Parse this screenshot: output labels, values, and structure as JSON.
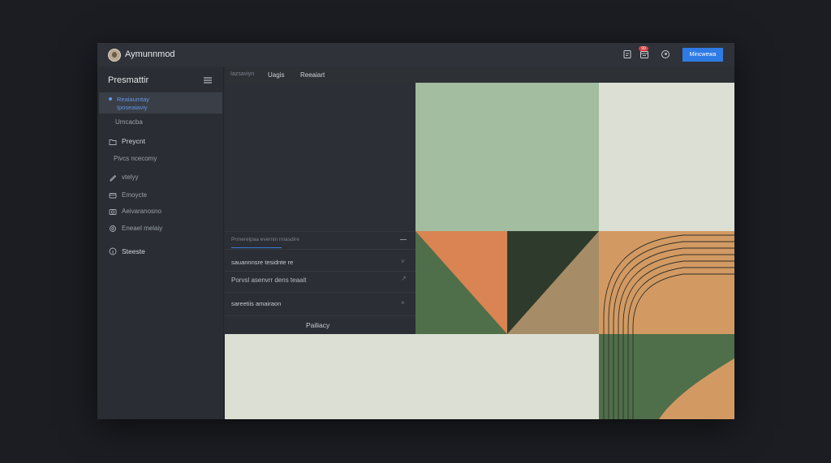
{
  "header": {
    "app_title": "Aymunnmod",
    "notification_badge": "99",
    "primary_button": "Mincwewa"
  },
  "sidebar": {
    "title": "Presmattir",
    "active_item": {
      "line1": "Reaiaumtay",
      "line2": "Iposeaiaviy"
    },
    "items": [
      {
        "label": "Umcacba"
      },
      {
        "label": "Preycnt"
      },
      {
        "label": "Pivcs ncecomy"
      },
      {
        "label": "vtelyy"
      },
      {
        "label": "Emoycte"
      },
      {
        "label": "Aeivaranosno"
      },
      {
        "label": "Eneael melaiy"
      },
      {
        "label": "Steeste"
      }
    ]
  },
  "main": {
    "tabs": [
      {
        "label": "Iazsaviyn"
      },
      {
        "label": "Uagis"
      },
      {
        "label": "Reeaiart"
      }
    ],
    "panel": {
      "header": "Prrnerelpaa evernin nnasdire",
      "rows": [
        {
          "label": "sauannnsre tesidnte re"
        },
        {
          "label": "Porvsl asenvrr dens teaait"
        },
        {
          "label": "sareetiis amairaon"
        }
      ],
      "button": "Pailiacy"
    }
  },
  "colors": {
    "sage": "#a3bda0",
    "cream": "#dcdfd3",
    "orange": "#d98452",
    "forest": "#4f6e4a",
    "dark_green": "#2e3b2c",
    "khaki": "#a68d68",
    "tan": "#d29a62",
    "accent": "#2f7be6"
  }
}
